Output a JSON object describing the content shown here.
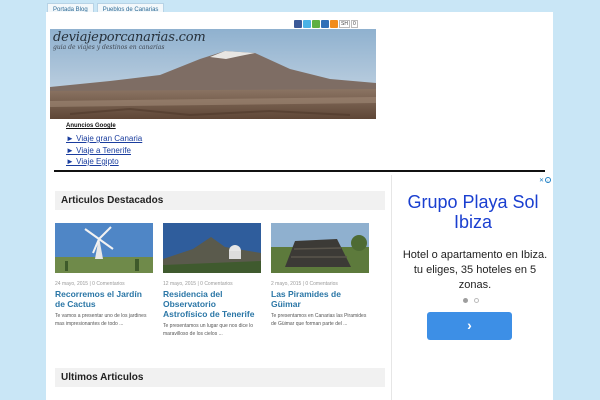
{
  "nav": {
    "tabs": [
      {
        "label": "Portada Blog"
      },
      {
        "label": "Pueblos de Canarias"
      }
    ]
  },
  "social": {
    "icons": [
      "facebook-icon",
      "twitter-icon",
      "googleplus-icon",
      "delicious-icon",
      "rss-icon"
    ],
    "share_label": "SH",
    "count": "0"
  },
  "header": {
    "site_title": "deviajeporcanarias.com",
    "tagline": "guia de viajes y destinos en canarias"
  },
  "google_ads": {
    "title": "Anuncios Google",
    "links": [
      "► Viaje gran Canaria",
      "► Viaje a Tenerife",
      "► Viaje Egipto"
    ]
  },
  "featured": {
    "heading": "Articulos Destacados",
    "articles": [
      {
        "meta": "24 mayo, 2015 | 0 Comentarios",
        "title": "Recorremos el Jardín de Cactus",
        "excerpt": "Te vamos a presentar uno de los jardines mas impresionantes de todo ..."
      },
      {
        "meta": "12 mayo, 2015 | 0 Comentarios",
        "title": "Residencia del Observatorio Astrofísico de Tenerife",
        "excerpt": "Te presentamos un lugar que nos dice lo maravilloso de los cielos ..."
      },
      {
        "meta": "2 mayo, 2015 | 0 Comentarios",
        "title": "Las Piramides de Güimar",
        "excerpt": "Te presentamos en Canarias las Piramides de Güimar que forman parte del ..."
      }
    ]
  },
  "latest": {
    "heading": "Ultimos Articulos"
  },
  "advert": {
    "headline": "Grupo Playa Sol Ibiza",
    "body": "Hotel o apartamento en Ibiza. tu eliges, 35 hoteles en 5 zonas.",
    "button_glyph": "›",
    "close_glyph": "✕",
    "info_glyph": "i",
    "dot_colors": [
      "#9e9e9e",
      "#ffffff"
    ],
    "button_color": "#3d8fe6",
    "headline_color": "#1a3fd0"
  },
  "colors": {
    "page_bg": "#c9e6f6",
    "link": "#2a76a6",
    "ad_link": "#1a3d9e"
  }
}
